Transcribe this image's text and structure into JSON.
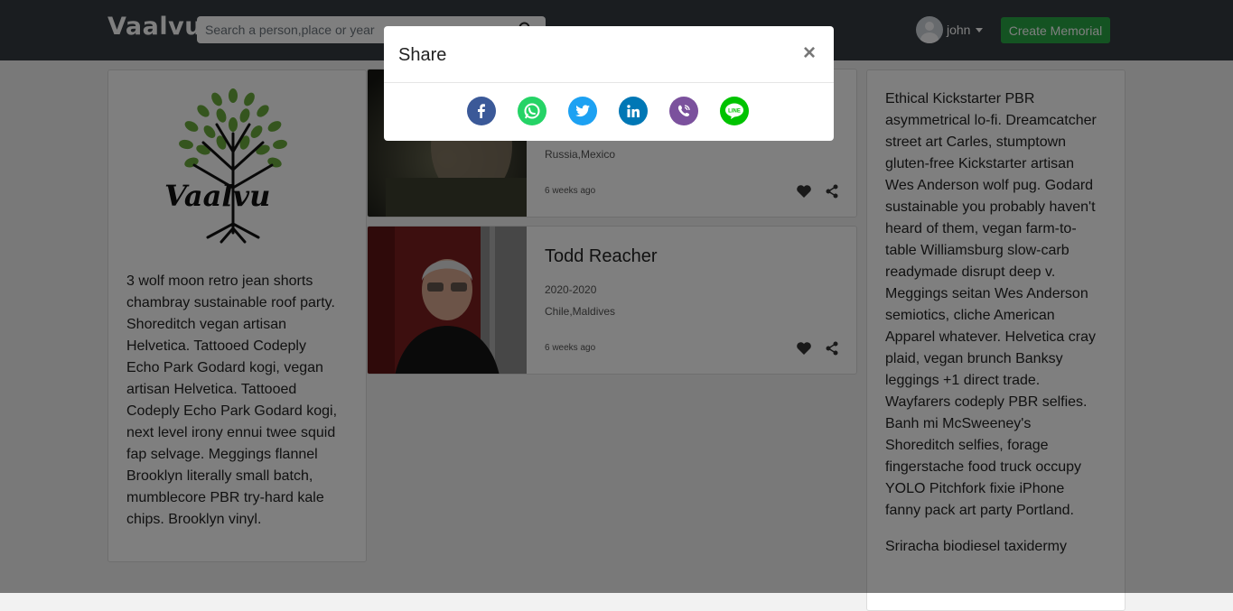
{
  "brand": "Vaalvu",
  "search": {
    "placeholder": "Search a person,place or year"
  },
  "user": {
    "name": "john"
  },
  "create_button": "Create Memorial",
  "left_text": "3 wolf moon retro jean shorts chambray sustainable roof party. Shoreditch vegan artisan Helvetica. Tattooed Codeply Echo Park Godard kogi, vegan artisan Helvetica. Tattooed Codeply Echo Park Godard kogi, next level irony ennui twee squid fap selvage. Meggings flannel Brooklyn literally small batch, mumblecore PBR try-hard kale chips. Brooklyn vinyl.",
  "right_text": [
    "Ethical Kickstarter PBR asymmetrical lo-fi. Dreamcatcher street art Carles, stumptown gluten-free Kickstarter artisan Wes Anderson wolf pug. Godard sustainable you probably haven't heard of them, vegan farm-to-table Williamsburg slow-carb readymade disrupt deep v. Meggings seitan Wes Anderson semiotics, cliche American Apparel whatever. Helvetica cray plaid, vegan brunch Banksy leggings +1 direct trade. Wayfarers codeply PBR selfies. Banh mi McSweeney's Shoreditch selfies, forage fingerstache food truck occupy YOLO Pitchfork fixie iPhone fanny pack art party Portland.",
    "Sriracha biodiesel taxidermy"
  ],
  "memorials": [
    {
      "name": "",
      "years": "",
      "places": "Russia,Mexico",
      "posted": "6 weeks ago"
    },
    {
      "name": "Todd Reacher",
      "years": "2020-2020",
      "places": "Chile,Maldives",
      "posted": "6 weeks ago"
    }
  ],
  "modal": {
    "title": "Share",
    "close": "×",
    "share_targets": [
      {
        "icon": "facebook-icon",
        "color": "#3b5998"
      },
      {
        "icon": "whatsapp-icon",
        "color": "#25d366"
      },
      {
        "icon": "twitter-icon",
        "color": "#1da1f2"
      },
      {
        "icon": "linkedin-icon",
        "color": "#0077b5"
      },
      {
        "icon": "viber-icon",
        "color": "#7b519d"
      },
      {
        "icon": "line-icon",
        "color": "#00c300"
      }
    ]
  },
  "colors": {
    "navbar": "#343a40",
    "create_button": "#28a745",
    "overlay": "rgba(0,0,0,0.5)"
  }
}
